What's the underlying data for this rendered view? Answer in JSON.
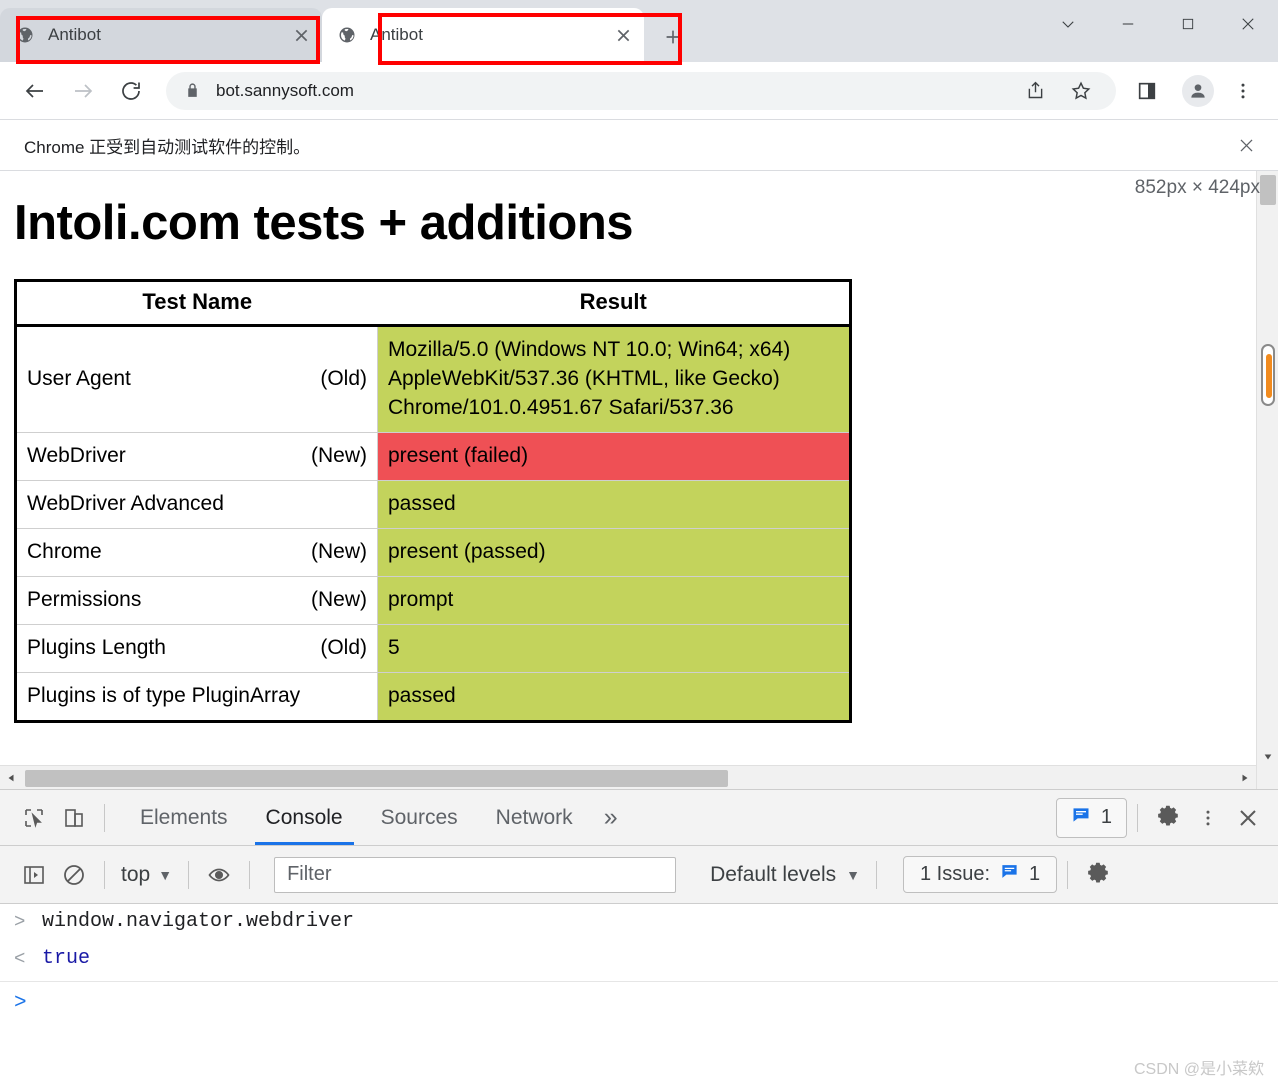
{
  "window": {
    "controls": [
      {
        "name": "tab-search-button",
        "glyph": "chevron-down"
      },
      {
        "name": "minimize-button",
        "glyph": "minimize"
      },
      {
        "name": "maximize-button",
        "glyph": "maximize"
      },
      {
        "name": "close-button",
        "glyph": "close"
      }
    ]
  },
  "tabs": [
    {
      "title": "Antibot",
      "active": false
    },
    {
      "title": "Antibot",
      "active": true
    }
  ],
  "newtab_tooltip": "New Tab",
  "toolbar": {
    "back": "Back",
    "forward": "Forward",
    "reload": "Reload",
    "url": "bot.sannysoft.com",
    "share": "Share",
    "bookmark": "Bookmark this tab",
    "side_panel": "Side panel",
    "profile": "Profile",
    "menu": "Customize and control Google Chrome"
  },
  "infobar": {
    "text": "Chrome 正受到自动测试软件的控制。",
    "close": "Close"
  },
  "viewport": {
    "size_tip": "852px × 424px"
  },
  "page": {
    "title": "Intoli.com tests + additions",
    "table": {
      "headers": [
        "Test Name",
        "Result"
      ],
      "rows": [
        {
          "name": "User Agent",
          "age": "(Old)",
          "result": "Mozilla/5.0 (Windows NT 10.0; Win64; x64) AppleWebKit/537.36 (KHTML, like Gecko) Chrome/101.0.4951.67 Safari/537.36",
          "status": "pass"
        },
        {
          "name": "WebDriver",
          "age": "(New)",
          "result": "present (failed)",
          "status": "fail"
        },
        {
          "name": "WebDriver Advanced",
          "age": "",
          "result": "passed",
          "status": "pass"
        },
        {
          "name": "Chrome",
          "age": "(New)",
          "result": "present (passed)",
          "status": "pass"
        },
        {
          "name": "Permissions",
          "age": "(New)",
          "result": "prompt",
          "status": "pass"
        },
        {
          "name": "Plugins Length",
          "age": "(Old)",
          "result": "5",
          "status": "pass"
        },
        {
          "name": "Plugins is of type PluginArray",
          "age": "",
          "result": "passed",
          "status": "pass"
        }
      ]
    },
    "colors": {
      "pass": "#c3d35c",
      "fail": "#ef5055"
    }
  },
  "devtools": {
    "inspect_tooltip": "Inspect element",
    "device_tooltip": "Toggle device toolbar",
    "tabs": [
      {
        "label": "Elements",
        "active": false
      },
      {
        "label": "Console",
        "active": true
      },
      {
        "label": "Sources",
        "active": false
      },
      {
        "label": "Network",
        "active": false
      }
    ],
    "more_tabs": "»",
    "issues_count": "1",
    "settings_tooltip": "Settings",
    "kebab_tooltip": "Customize and control DevTools",
    "close_tooltip": "Close DevTools",
    "console_toolbar": {
      "sidebar_tooltip": "Show console sidebar",
      "clear_tooltip": "Clear console",
      "context": "top",
      "eye_tooltip": "Create live expression",
      "filter_placeholder": "Filter",
      "levels": "Default levels",
      "issues_label": "1 Issue:",
      "issues_badge": "1",
      "settings_tooltip": "Console settings"
    },
    "console": {
      "input_prompt": ">",
      "output_prompt": "<",
      "entries": [
        {
          "kind": "input",
          "text": "window.navigator.webdriver"
        },
        {
          "kind": "output",
          "text": "true"
        }
      ],
      "prompt_caret": ">"
    }
  },
  "watermark": "CSDN @是小菜欸",
  "accent": "#1a73e8",
  "annotation_color": "#ff0000"
}
